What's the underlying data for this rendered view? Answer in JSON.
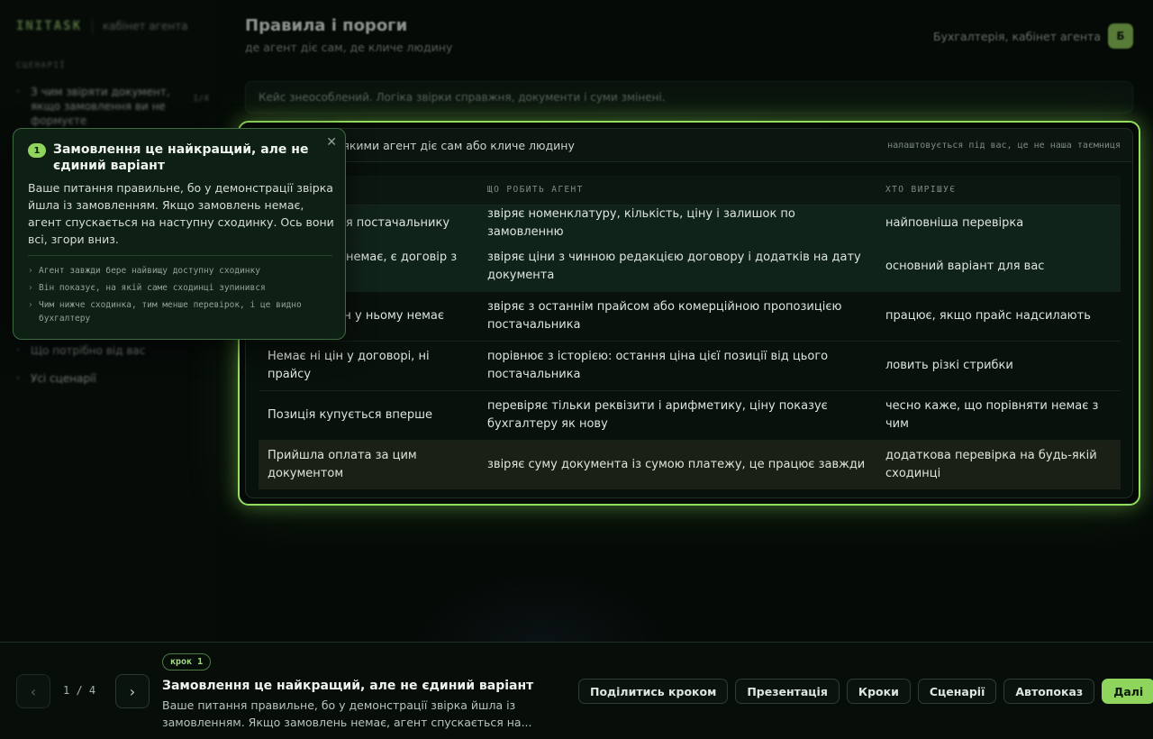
{
  "sidebar": {
    "logo": "INITASK",
    "subtitle": "кабінет агента",
    "section_label": "СЦЕНАРІЇ",
    "items": [
      {
        "label": "З чим звіряти документ, якщо замовлення ви не формуєте",
        "count": "1/4"
      },
      {
        "label": "Що потрібно від вас"
      },
      {
        "label": "Усі сценарії"
      }
    ]
  },
  "header": {
    "title": "Правила і пороги",
    "subtitle": "де агент діє сам, де кличе людину",
    "user": "Бухгалтерія, кабінет агента",
    "avatar_initial": "Б"
  },
  "notice": "Кейс знеособлений. Логіка звірки справжня, документи і суми змінені.",
  "rules": {
    "title": "Правила, за якими агент діє сам або кличе людину",
    "note": "налаштовується під вас, це не наша таємниця",
    "columns": [
      "ДЖЕРЕЛО",
      "ЩО РОБИТЬ АГЕНТ",
      "ХТО ВИРІШУЄ"
    ],
    "rows": [
      {
        "source": "Є замовлення постачальнику",
        "action": "звіряє номенклатуру, кількість, ціну і залишок по замовленню",
        "decides": "найповніша перевірка"
      },
      {
        "source": "Замовлення немає, є договір з цінами",
        "action": "звіряє ціни з чинною редакцією договору і додатків на дату документа",
        "decides": "основний варіант для вас"
      },
      {
        "source": "Договір є, цін у ньому немає",
        "action": "звіряє з останнім прайсом або комерційною пропозицією постачальника",
        "decides": "працює, якщо прайс надсилають"
      },
      {
        "source": "Немає ні цін у договорі, ні прайсу",
        "action": "порівнює з історією: остання ціна цієї позиції від цього постачальника",
        "decides": "ловить різкі стрибки"
      },
      {
        "source": "Позиція купується вперше",
        "action": "перевіряє тільки реквізити і арифметику, ціну показує бухгалтеру як нову",
        "decides": "чесно каже, що порівняти немає з чим"
      },
      {
        "source": "Прийшла оплата за цим документом",
        "action": "звіряє суму документа із сумою платежу, це працює завжди",
        "decides": "додаткова перевірка на будь-якій сходинці"
      }
    ]
  },
  "tooltip": {
    "step_number": "1",
    "title": "Замовлення це найкращий, але не єдиний варіант",
    "body": "Ваше питання правильне, бо у демонстрації звірка йшла із замовленням. Якщо замовлень немає, агент спускається на наступну сходинку. Ось вони всі, згори вниз.",
    "bullets": [
      "Агент завжди бере найвищу доступну сходинку",
      "Він показує, на якій саме сходинці зупинився",
      "Чим нижче сходинка, тим менше перевірок, і це видно бухгалтеру"
    ]
  },
  "bottom": {
    "page_counter": "1 / 4",
    "step_pill": "крок 1",
    "step_title": "Замовлення це найкращий, але не єдиний варіант",
    "step_text": "Ваше питання правильне, бо у демонстрації звірка йшла із замовленням. Якщо замовлень немає, агент спускається на...",
    "buttons": {
      "share": "Поділитись кроком",
      "presentation": "Презентація",
      "steps": "Кроки",
      "scenarios": "Сценарії",
      "autoplay": "Автопоказ",
      "next": "Далі"
    }
  },
  "colors": {
    "accent": "#8fd45c",
    "highlight_border": "#93dd5f",
    "background": "#050a07"
  }
}
